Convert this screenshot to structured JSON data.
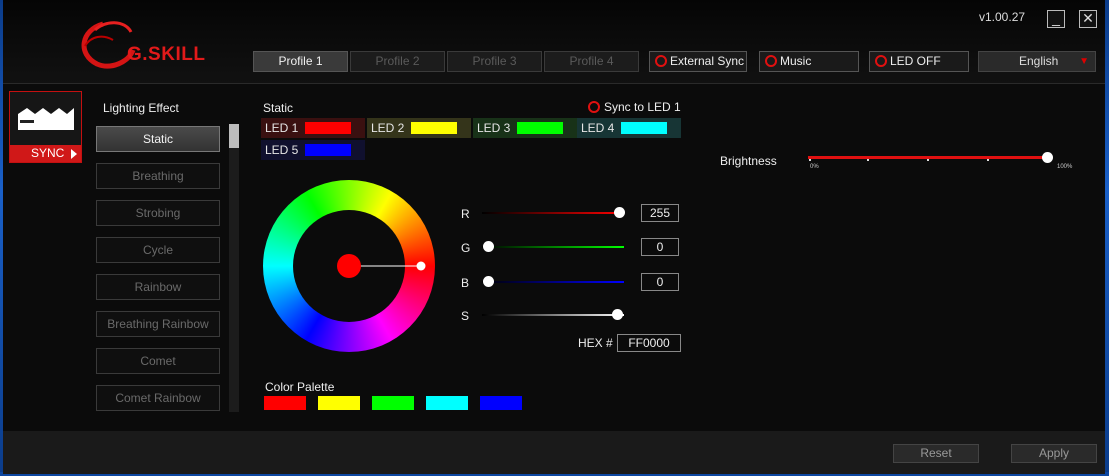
{
  "app": {
    "brand": "G.SKILL",
    "version": "v1.00.27"
  },
  "window_controls": {
    "minimize": "_",
    "close": "✕"
  },
  "profiles": [
    {
      "label": "Profile 1",
      "active": true
    },
    {
      "label": "Profile 2",
      "active": false
    },
    {
      "label": "Profile 3",
      "active": false
    },
    {
      "label": "Profile 4",
      "active": false
    }
  ],
  "header_buttons": {
    "external_sync": "External Sync",
    "music": "Music",
    "led_off": "LED OFF"
  },
  "language": {
    "selected": "English"
  },
  "sync_panel": {
    "label": "SYNC"
  },
  "lighting": {
    "title": "Lighting Effect",
    "effects": [
      "Static",
      "Breathing",
      "Strobing",
      "Cycle",
      "Rainbow",
      "Breathing Rainbow",
      "Comet",
      "Comet Rainbow"
    ],
    "selected": "Static"
  },
  "static": {
    "title": "Static",
    "sync_to_led1": "Sync to LED 1",
    "leds": [
      {
        "label": "LED 1",
        "color": "#ff0000"
      },
      {
        "label": "LED 2",
        "color": "#ffff00"
      },
      {
        "label": "LED 3",
        "color": "#00ff00"
      },
      {
        "label": "LED 4",
        "color": "#00ffff"
      },
      {
        "label": "LED 5",
        "color": "#0000ff"
      }
    ]
  },
  "rgb": {
    "r_label": "R",
    "r_value": "255",
    "g_label": "G",
    "g_value": "0",
    "b_label": "B",
    "b_value": "0",
    "s_label": "S",
    "hex_label": "HEX #",
    "hex_value": "FF0000"
  },
  "palette": {
    "title": "Color Palette",
    "colors": [
      "#ff0000",
      "#ffff00",
      "#00ff00",
      "#00ffff",
      "#0000ff"
    ]
  },
  "brightness": {
    "label": "Brightness",
    "min_label": "0%",
    "max_label": "100%",
    "value_percent": 100
  },
  "footer": {
    "reset": "Reset",
    "apply": "Apply"
  },
  "colors": {
    "accent": "#e01010"
  }
}
